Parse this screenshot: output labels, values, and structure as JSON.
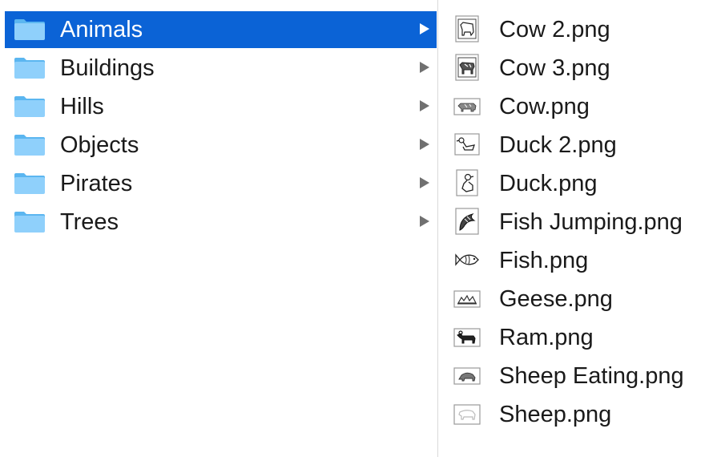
{
  "colors": {
    "selection": "#0b63d6",
    "folder_light": "#8fd0fb",
    "folder_dark": "#5bb6f0",
    "chevron": "#707070",
    "divider": "#d9d9d9"
  },
  "folders": [
    {
      "label": "Animals",
      "icon": "folder-icon",
      "selected": true
    },
    {
      "label": "Buildings",
      "icon": "folder-icon",
      "selected": false
    },
    {
      "label": "Hills",
      "icon": "folder-icon",
      "selected": false
    },
    {
      "label": "Objects",
      "icon": "folder-icon",
      "selected": false
    },
    {
      "label": "Pirates",
      "icon": "folder-icon",
      "selected": false
    },
    {
      "label": "Trees",
      "icon": "folder-icon",
      "selected": false
    }
  ],
  "files": [
    {
      "label": "Cow 2.png",
      "icon": "cow-thumbnail-icon"
    },
    {
      "label": "Cow 3.png",
      "icon": "cow-thumbnail-icon"
    },
    {
      "label": "Cow.png",
      "icon": "cow-thumbnail-icon"
    },
    {
      "label": "Duck 2.png",
      "icon": "duck-thumbnail-icon"
    },
    {
      "label": "Duck.png",
      "icon": "duck-thumbnail-icon"
    },
    {
      "label": "Fish Jumping.png",
      "icon": "fish-jumping-thumbnail-icon"
    },
    {
      "label": "Fish.png",
      "icon": "fish-thumbnail-icon"
    },
    {
      "label": "Geese.png",
      "icon": "geese-thumbnail-icon"
    },
    {
      "label": "Ram.png",
      "icon": "ram-thumbnail-icon"
    },
    {
      "label": "Sheep Eating.png",
      "icon": "sheep-eating-thumbnail-icon"
    },
    {
      "label": "Sheep.png",
      "icon": "sheep-thumbnail-icon"
    }
  ]
}
